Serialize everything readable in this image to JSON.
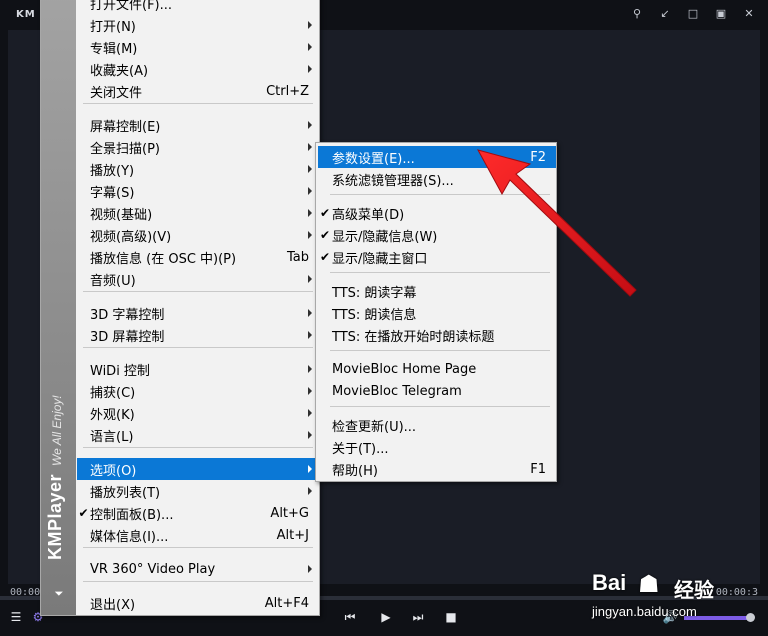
{
  "player": {
    "logo": "KM",
    "window_buttons": [
      "⚲",
      "↙",
      "□",
      "▣",
      "✕"
    ],
    "time_left": "00:00:3",
    "time_right": "00:00:3",
    "volume": 0.95,
    "colors": {
      "background": "#161922",
      "frame": "#0f1116",
      "volume_accent": "#7d5ce6"
    },
    "control_icons": {
      "playlist": "playlist-icon",
      "settings": "gear-icon",
      "prev": "previous-track-icon",
      "play": "play-icon",
      "next": "next-track-icon",
      "stop": "stop-icon",
      "volume": "speaker-icon"
    }
  },
  "main_menu": {
    "strip_brand": "KMPlayer",
    "strip_tagline": "We All Enjoy!",
    "items": [
      {
        "label": "打开文件(F)...",
        "shortcut": "",
        "submenu": false,
        "checked": false
      },
      {
        "label": "打开(N)",
        "shortcut": "",
        "submenu": true,
        "checked": false
      },
      {
        "label": "专辑(M)",
        "shortcut": "",
        "submenu": true,
        "checked": false
      },
      {
        "label": "收藏夹(A)",
        "shortcut": "",
        "submenu": true,
        "checked": false
      },
      {
        "label": "关闭文件",
        "shortcut": "Ctrl+Z",
        "submenu": false,
        "checked": false
      },
      {
        "label": "屏幕控制(E)",
        "shortcut": "",
        "submenu": true,
        "checked": false
      },
      {
        "label": "全景扫描(P)",
        "shortcut": "",
        "submenu": true,
        "checked": false
      },
      {
        "label": "播放(Y)",
        "shortcut": "",
        "submenu": true,
        "checked": false
      },
      {
        "label": "字幕(S)",
        "shortcut": "",
        "submenu": true,
        "checked": false
      },
      {
        "label": "视频(基础)",
        "shortcut": "",
        "submenu": true,
        "checked": false
      },
      {
        "label": "视频(高级)(V)",
        "shortcut": "",
        "submenu": true,
        "checked": false
      },
      {
        "label": "播放信息 (在 OSC 中)(P)",
        "shortcut": "Tab",
        "submenu": false,
        "checked": false
      },
      {
        "label": "音频(U)",
        "shortcut": "",
        "submenu": true,
        "checked": false
      },
      {
        "label": "3D 字幕控制",
        "shortcut": "",
        "submenu": true,
        "checked": false
      },
      {
        "label": "3D 屏幕控制",
        "shortcut": "",
        "submenu": true,
        "checked": false
      },
      {
        "label": "WiDi 控制",
        "shortcut": "",
        "submenu": true,
        "checked": false
      },
      {
        "label": "捕获(C)",
        "shortcut": "",
        "submenu": true,
        "checked": false
      },
      {
        "label": "外观(K)",
        "shortcut": "",
        "submenu": true,
        "checked": false
      },
      {
        "label": "语言(L)",
        "shortcut": "",
        "submenu": true,
        "checked": false
      },
      {
        "label": "选项(O)",
        "shortcut": "",
        "submenu": true,
        "checked": false,
        "highlighted": true
      },
      {
        "label": "播放列表(T)",
        "shortcut": "",
        "submenu": true,
        "checked": false
      },
      {
        "label": "控制面板(B)...",
        "shortcut": "Alt+G",
        "submenu": false,
        "checked": true
      },
      {
        "label": "媒体信息(I)...",
        "shortcut": "Alt+J",
        "submenu": false,
        "checked": false
      },
      {
        "label": "VR 360° Video Play",
        "shortcut": "",
        "submenu": true,
        "checked": false
      },
      {
        "label": "退出(X)",
        "shortcut": "Alt+F4",
        "submenu": false,
        "checked": false
      }
    ]
  },
  "options_submenu": {
    "items": [
      {
        "label": "参数设置(E)...",
        "shortcut": "F2",
        "checked": false,
        "highlighted": true
      },
      {
        "label": "系统滤镜管理器(S)...",
        "shortcut": "",
        "checked": false
      },
      {
        "label": "高级菜单(D)",
        "shortcut": "",
        "checked": true
      },
      {
        "label": "显示/隐藏信息(W)",
        "shortcut": "",
        "checked": true
      },
      {
        "label": "显示/隐藏主窗口",
        "shortcut": "",
        "checked": true
      },
      {
        "label": "TTS: 朗读字幕",
        "shortcut": "",
        "checked": false
      },
      {
        "label": "TTS: 朗读信息",
        "shortcut": "",
        "checked": false
      },
      {
        "label": "TTS: 在播放开始时朗读标题",
        "shortcut": "",
        "checked": false
      },
      {
        "label": "MovieBloc Home Page",
        "shortcut": "",
        "checked": false
      },
      {
        "label": "MovieBloc Telegram",
        "shortcut": "",
        "checked": false
      },
      {
        "label": "检查更新(U)...",
        "shortcut": "",
        "checked": false
      },
      {
        "label": "关于(T)...",
        "shortcut": "",
        "checked": false
      },
      {
        "label": "帮助(H)",
        "shortcut": "F1",
        "checked": false
      }
    ]
  },
  "accent_colors": {
    "highlight": "#0b78d6",
    "arrow": "#e8141c"
  },
  "watermark": {
    "logo": "Bai",
    "paw": "☗",
    "text": "经验",
    "url": "jingyan.baidu.com"
  }
}
